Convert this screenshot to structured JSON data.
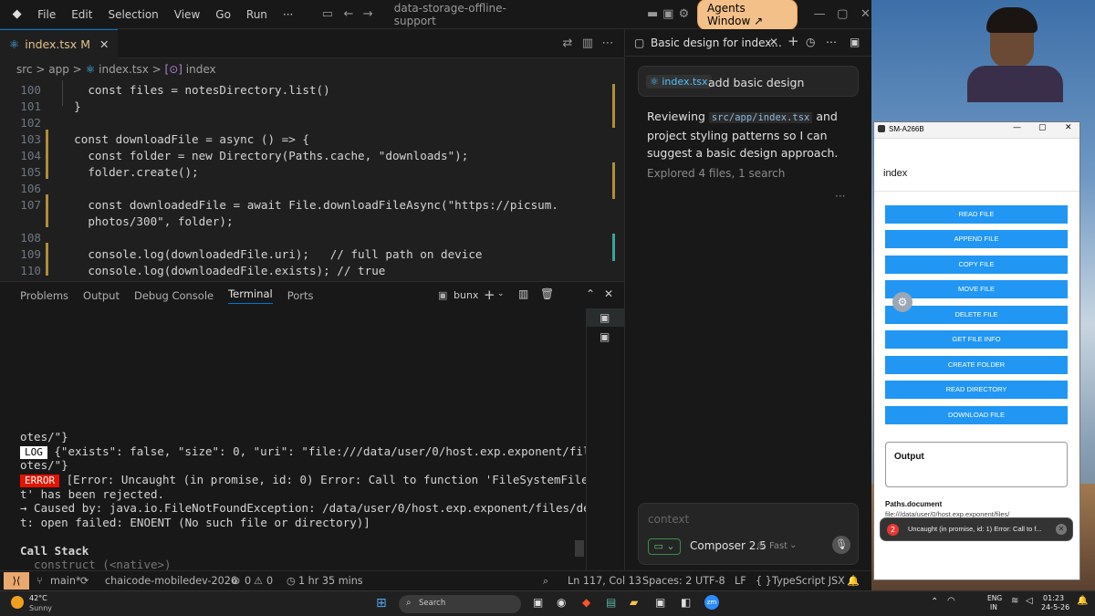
{
  "titlebar": {
    "menu": [
      "File",
      "Edit",
      "Selection",
      "View",
      "Go",
      "Run",
      "···"
    ],
    "search": "data-storage-offline-support",
    "agents_window": "Agents Window ↗"
  },
  "editor": {
    "tab": {
      "name": "index.tsx",
      "modified": "M"
    },
    "breadcrumb": [
      "src",
      "app",
      "index.tsx",
      "index"
    ],
    "lines": [
      {
        "num": "100",
        "text": "    const files = notesDirectory.list()"
      },
      {
        "num": "101",
        "text": "  }"
      },
      {
        "num": "102",
        "text": ""
      },
      {
        "num": "103",
        "text": "  const downloadFile = async () => {"
      },
      {
        "num": "104",
        "text": "    const folder = new Directory(Paths.cache, \"downloads\");"
      },
      {
        "num": "105",
        "text": "    folder.create();"
      },
      {
        "num": "106",
        "text": ""
      },
      {
        "num": "107",
        "text": "    const downloadedFile = await File.downloadFileAsync(\"https://picsum."
      },
      {
        "num": "",
        "text": "    photos/300\", folder);"
      },
      {
        "num": "108",
        "text": ""
      },
      {
        "num": "109",
        "text": "    console.log(downloadedFile.uri);   // full path on device"
      },
      {
        "num": "110",
        "text": "    console.log(downloadedFile.exists); // true"
      }
    ]
  },
  "panel": {
    "tabs": [
      "Problems",
      "Output",
      "Debug Console",
      "Terminal",
      "Ports"
    ],
    "active": "Terminal",
    "shell": "bunx",
    "terminal_lines": [
      "otes/\"}",
      {
        "badge": "LOG",
        "text": " {\"exists\": false, \"size\": 0, \"uri\": \"file:///data/user/0/host.exp.exponent/files/n"
      },
      "otes/\"}",
      {
        "badge": "ERROR",
        "text": " [Error: Uncaught (in promise, id: 0) Error: Call to function 'FileSystemFile.tex"
      },
      "t' has been rejected.",
      "→ Caused by: java.io.FileNotFoundException: /data/user/0/host.exp.exponent/files/demo.tx",
      "t: open failed: ENOENT (No such file or directory)]",
      "",
      "Call Stack",
      "  construct (<native>)"
    ]
  },
  "statusbar": {
    "branch": "main*",
    "workspace": "chaicode-mobiledev-2026",
    "errors": "0",
    "warnings": "0",
    "time": "1 hr 35 mins",
    "position": "Ln 117, Col 13",
    "spaces": "Spaces: 2",
    "encoding": "UTF-8",
    "eol": "LF",
    "language": "TypeScript JSX"
  },
  "chat": {
    "title": "Basic design for index...",
    "user_chip": "index.tsx",
    "user_message": "add basic design",
    "reply_pre": "Reviewing ",
    "reply_code": "src/app/index.tsx",
    "reply_post": " and project styling patterns so I can suggest a basic design approach.",
    "explored": "Explored 4 files, 1 search",
    "more": "···",
    "placeholder": "context",
    "model": "Composer 2.5",
    "speed": "Fast"
  },
  "phone": {
    "window_title": "SM-A266B",
    "screen_title": "index",
    "buttons": [
      "READ FILE",
      "APPEND FILE",
      "COPY FILE",
      "MOVE FILE",
      "DELETE FILE",
      "GET FILE INFO",
      "CREATE FOLDER",
      "READ DIRECTORY",
      "DOWNLOAD FILE"
    ],
    "output_label": "Output",
    "paths_label": "Paths.document",
    "paths_value": "file:///data/user/0/host.exp.exponent/files/",
    "toast_count": "2",
    "toast_text": "Uncaught (in promise, id: 1) Error: Call to f..."
  },
  "taskbar": {
    "weather_temp": "42°C",
    "weather_desc": "Sunny",
    "search": "Search",
    "lang1": "ENG",
    "lang2": "IN",
    "time": "01:23",
    "date": "24-5-26"
  },
  "colors": {
    "accent": "#0078d4",
    "agents": "#f3c089",
    "log_bg": "#ffffff",
    "error_bg": "#e51400",
    "phone_button": "#2196f3"
  }
}
